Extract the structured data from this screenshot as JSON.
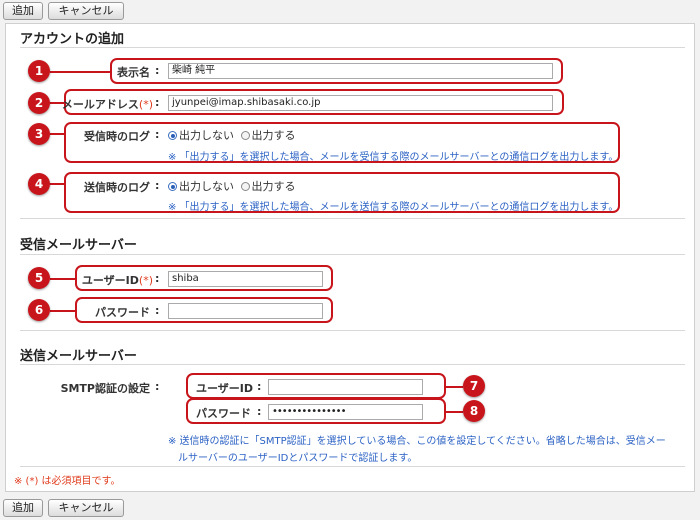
{
  "toolbar": {
    "add_label": "追加",
    "cancel_label": "キャンセル"
  },
  "sections": {
    "account_title": "アカウントの追加",
    "incoming_title": "受信メールサーバー",
    "outgoing_title": "送信メールサーバー"
  },
  "form": {
    "colon": ":",
    "required_mark": "(*)",
    "display_name": {
      "label": "表示名",
      "value": "柴崎 純平"
    },
    "mail_address": {
      "label": "メールアドレス",
      "value": "jyunpei@imap.shibasaki.co.jp"
    },
    "receive_log": {
      "label": "受信時のログ",
      "options": [
        "出力しない",
        "出力する"
      ],
      "selected": "出力しない",
      "note": "※ 「出力する」を選択した場合、メールを受信する際のメールサーバーとの通信ログを出力します。"
    },
    "send_log": {
      "label": "送信時のログ",
      "options": [
        "出力しない",
        "出力する"
      ],
      "selected": "出力しない",
      "note": "※ 「出力する」を選択した場合、メールを送信する際のメールサーバーとの通信ログを出力します。"
    },
    "incoming_user": {
      "label": "ユーザーID",
      "value": "shiba"
    },
    "incoming_password": {
      "label": "パスワード",
      "value": ""
    },
    "smtp_auth": {
      "label": "SMTP認証の設定",
      "user_label": "ユーザーID",
      "user_value": "",
      "password_label": "パスワード",
      "password_value": "•••••••••••••••",
      "note_line1": "※ 送信時の認証に「SMTP認証」を選択している場合、この値を設定してください。省略した場合は、受信メー",
      "note_line2": "ルサーバーのユーザーIDとパスワードで認証します。"
    },
    "required_note": "※ (*) は必須項目です。"
  },
  "callouts": [
    "1",
    "2",
    "3",
    "4",
    "5",
    "6",
    "7",
    "8"
  ],
  "colors": {
    "callout": "#c8151b",
    "note": "#2c62c4",
    "required": "#e03c1e"
  }
}
